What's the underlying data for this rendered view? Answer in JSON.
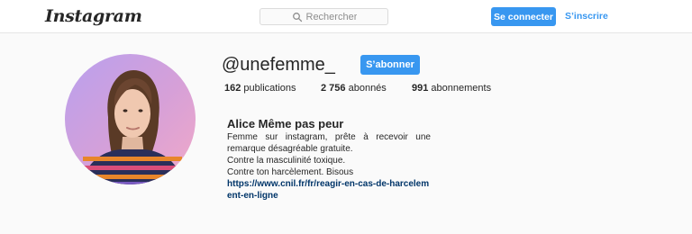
{
  "header": {
    "logo_text": "Instagram",
    "search_placeholder": "Rechercher",
    "login_label": "Se connecter",
    "signup_label": "S’inscrire"
  },
  "profile": {
    "username": "@unefemme_",
    "follow_label": "S’abonner",
    "stats": {
      "posts_count": "162",
      "posts_label": "publications",
      "followers_count": "2 756",
      "followers_label": "abonnés",
      "following_count": "991",
      "following_label": "abonnements"
    },
    "bio": {
      "name": "Alice Même pas peur",
      "line1": "Femme sur instagram, prête à recevoir une remarque désagréable gratuite.",
      "line2": "Contre la masculinité toxique.",
      "line3": "Contre ton harcèlement. Bisous",
      "link": "https://www.cnil.fr/fr/reagir-en-cas-de-harcelement-en-ligne"
    }
  },
  "colors": {
    "accent": "#3897f0",
    "link": "#003569",
    "background": "#fafafa"
  }
}
